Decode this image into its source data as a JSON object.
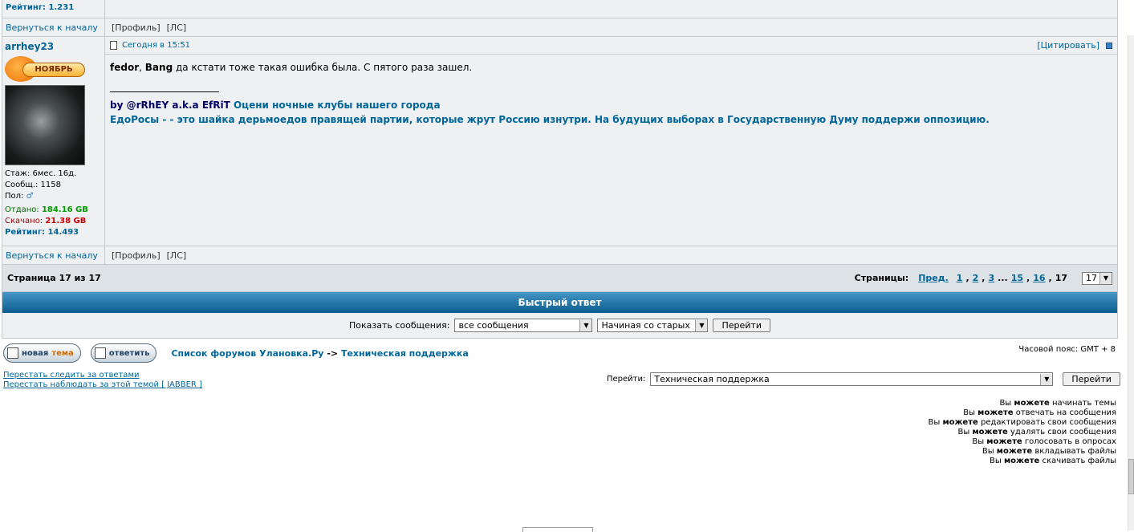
{
  "prev_post": {
    "rating": "Рейтинг: 1.231",
    "back_to_top": "Вернуться к началу",
    "profile": "[Профиль]",
    "pm": "[ЛС]"
  },
  "post": {
    "author": "arrhey23",
    "badge_text": "НОЯБРЬ",
    "stats": {
      "tenure_label": "Стаж:",
      "tenure_value": "6мес. 16д.",
      "posts_label": "Сообщ.:",
      "posts_value": "1158",
      "gender_label": "Пол:",
      "uploaded_label": "Отдано:",
      "uploaded_value": "184.16 GB",
      "downloaded_label": "Скачано:",
      "downloaded_value": "21.38 GB",
      "rating": "Рейтинг: 14.493"
    },
    "date": "Сегодня в 15:51",
    "quote": "[Цитировать]",
    "body": {
      "name1": "fedor",
      "comma": ",",
      "name2": "Bang",
      "text": "да кстати тоже такая ошибка была. С пятого раза зашел."
    },
    "signature": {
      "by": "by @rRhEY a.k.a EfRiT",
      "link": "Оцени ночные клубы нашего города",
      "line2": "ЕдоРосы - - это шайка дерьмоедов правящей партии, которые жрут Россию изнутри. На будущих выборах в Государственную Думу поддержи оппозицию."
    },
    "back_to_top": "Вернуться к началу",
    "profile": "[Профиль]",
    "pm": "[ЛС]"
  },
  "pagination": {
    "page_info": "Страница 17 из 17",
    "pages_label": "Страницы:",
    "prev": "Пред.",
    "p1": "1",
    "p2": "2",
    "p3": "3",
    "ellipsis": "...",
    "p15": "15",
    "p16": "16",
    "current": "17",
    "select_value": "17",
    "comma": ","
  },
  "quick_reply": {
    "title": "Быстрый ответ",
    "show_label": "Показать сообщения:",
    "show_select": "все сообщения",
    "order_select": "Начиная со старых",
    "go": "Перейти"
  },
  "footer": {
    "new_topic_a": "новая",
    "new_topic_b": "тема",
    "reply": "ответить",
    "crumb1": "Список форумов Улановка.Ру",
    "crumb_sep": "->",
    "crumb2": "Техническая поддержка",
    "timezone": "Часовой пояс: GMT + 8",
    "stop_watch_replies": "Перестать следить за ответами",
    "stop_watch_jabber": "Перестать наблюдать за этой темой [ JABBER ]",
    "jump_label": "Перейти:",
    "jump_select": "Техническая поддержка",
    "jump_go": "Перейти",
    "permissions": [
      {
        "pre": "Вы",
        "mid": "можете",
        "post": "начинать темы"
      },
      {
        "pre": "Вы",
        "mid": "можете",
        "post": "отвечать на сообщения"
      },
      {
        "pre": "Вы",
        "mid": "можете",
        "post": "редактировать свои сообщения"
      },
      {
        "pre": "Вы",
        "mid": "можете",
        "post": "удалять свои сообщения"
      },
      {
        "pre": "Вы",
        "mid": "можете",
        "post": "голосовать в опросах"
      },
      {
        "pre": "Вы",
        "mid": "можете",
        "post": "вкладывать файлы"
      },
      {
        "pre": "Вы",
        "mid": "можете",
        "post": "скачивать файлы"
      }
    ]
  },
  "colors": {
    "link": "#006699",
    "header_blue": "#0b5d8e",
    "panel_bg": "#eef0f2",
    "border": "#c3c9cf"
  }
}
